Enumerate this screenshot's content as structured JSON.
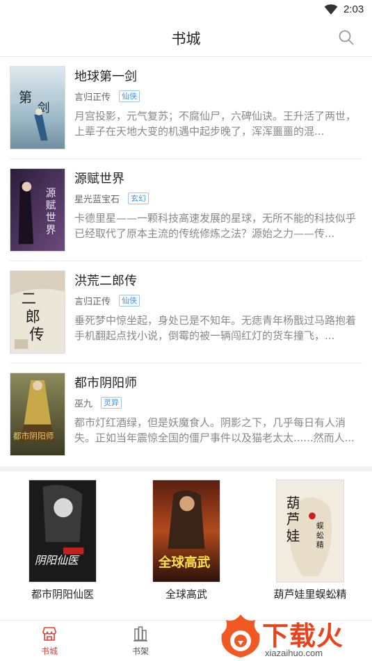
{
  "status_bar": {
    "time": "2:03"
  },
  "header": {
    "title": "书城",
    "search_icon": "search-icon"
  },
  "books": [
    {
      "title": "地球第一剑",
      "author": "言归正传",
      "tag": "仙侠",
      "desc": "月宫投影，元气复苏；不腐仙尸，六碑仙诀。王升活了两世，上辈子在天地大变的机遇中起步晚了，浑浑噩噩的混..."
    },
    {
      "title": "源赋世界",
      "author": "星光蓝宝石",
      "tag": "玄幻",
      "desc": "卡德里星——一颗科技高速发展的星球，无所不能的科技似乎已经取代了原本主流的传统修炼之法？源始之力——传..."
    },
    {
      "title": "洪荒二郎传",
      "author": "言归正传",
      "tag": "仙侠",
      "desc": "垂死梦中惊坐起，身处已是不知年。无痣青年杨戬过马路抱着手机翻起点找小说，倒霉的被一辆闯红灯的货车撞飞，..."
    },
    {
      "title": "都市阴阳师",
      "author": "巫九",
      "tag": "灵异",
      "desc": "都市灯红酒绿，但是妖魔食人。阴影之下，几乎每日有人消失。正如当年震惊全国的僵尸事件以及猫老太太......然而人..."
    }
  ],
  "featured": [
    {
      "name": "都市阴阳仙医"
    },
    {
      "name": "全球高武"
    },
    {
      "name": "葫芦娃里蜈蚣精"
    }
  ],
  "nav": {
    "items": [
      {
        "label": "书城",
        "icon": "store-icon",
        "active": true
      },
      {
        "label": "书架",
        "icon": "bookshelf-icon",
        "active": false
      }
    ],
    "active_color": "#e83b2e"
  },
  "watermark": {
    "text": "下载火",
    "url": "xiazaihuo.com"
  },
  "colors": {
    "accent": "#e83b2e",
    "tag_blue": "#3d8fe6"
  }
}
